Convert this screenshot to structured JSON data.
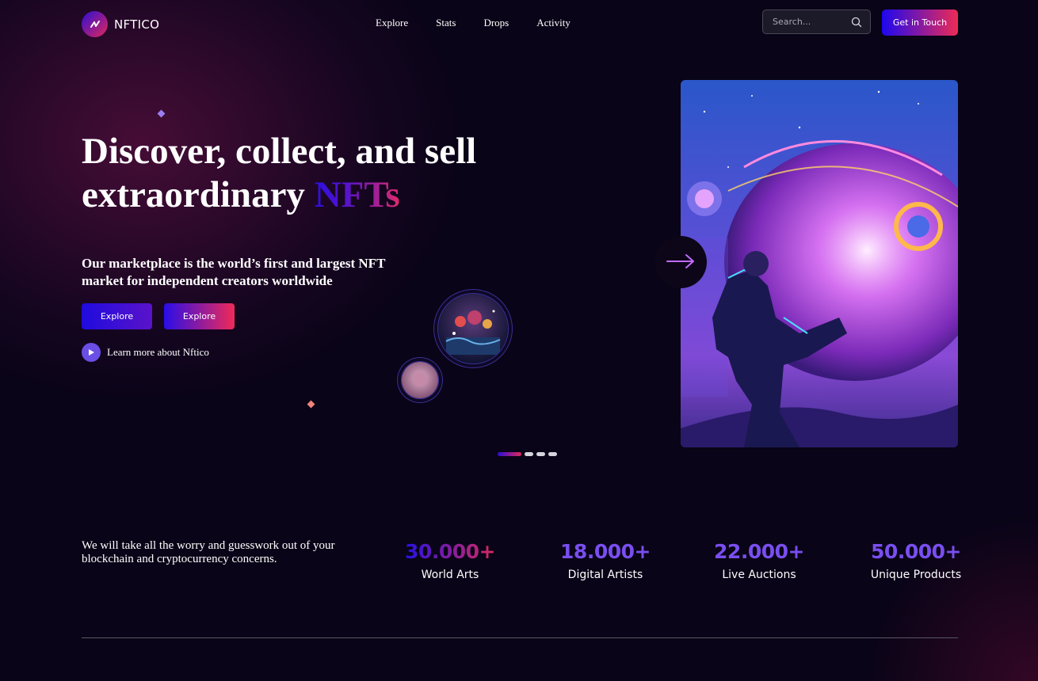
{
  "brand": {
    "name": "NFTICO",
    "accent_start": "#1d08ef",
    "accent_end": "#ee2b55"
  },
  "nav": {
    "items": [
      {
        "label": "Explore"
      },
      {
        "label": "Stats"
      },
      {
        "label": "Drops"
      },
      {
        "label": "Activity"
      }
    ],
    "search_placeholder": "Search...",
    "cta_label": "Get in Touch"
  },
  "hero": {
    "title_line1": "Discover, collect, and sell",
    "title_line2": "extraordinary ",
    "title_highlight": "NFTs",
    "subtitle": "Our marketplace is the world’s first and largest NFT market for independent creators worldwide",
    "buttons": [
      {
        "label": "Explore"
      },
      {
        "label": "Explore"
      }
    ],
    "learn_more": "Learn more about Nftico",
    "slider": {
      "active_index": 0,
      "count": 4
    }
  },
  "stats": {
    "tagline": "We will take all the worry and guesswork out of your blockchain and cryptocurrency concerns.",
    "items": [
      {
        "value": "30.000+",
        "label": "World Arts"
      },
      {
        "value": "18.000+",
        "label": "Digital Artists"
      },
      {
        "value": "22.000+",
        "label": "Live Auctions"
      },
      {
        "value": "50.000+",
        "label": "Unique Products"
      }
    ]
  },
  "icons": [
    "logo-icon",
    "search-icon",
    "play-icon",
    "arrow-right-icon"
  ]
}
